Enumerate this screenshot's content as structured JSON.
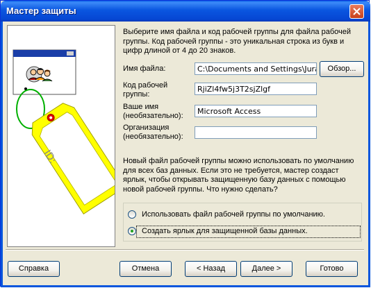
{
  "window": {
    "title": "Мастер защиты"
  },
  "intro_text": "Выберите имя файла и код рабочей группы для файла рабочей группы.  Код рабочей группы - это уникальная строка из букв и цифр длиной от 4 до 20 знаков.",
  "form": {
    "file_label": "Имя файла:",
    "file_value": "C:\\Documents and Settings\\Jura\\Pa",
    "browse_label": "Обзор...",
    "code_label_line1": "Код рабочей",
    "code_label_line2": "группы:",
    "code_value": "RjiZl4fw5j3T2sjZlgf",
    "name_label_line1": "Ваше имя",
    "name_label_line2": "(необязательно):",
    "name_value": "Microsoft Access",
    "org_label_line1": "Организация",
    "org_label_line2": "(необязательно):",
    "org_value": ""
  },
  "description": "Новый файл рабочей группы можно использовать по умолчанию для всех баз данных.  Если это не требуется, мастер создаст ярлык, чтобы открывать защищенную базу данных с помощью новой рабочей группы. Что нужно сделать?",
  "options": [
    {
      "label": "Использовать файл рабочей группы по умолчанию.",
      "selected": false
    },
    {
      "label": "Создать ярлык для защищенной базы данных.",
      "selected": true
    }
  ],
  "illustration": {
    "tag_text": "ID:"
  },
  "buttons": {
    "help": "Справка",
    "cancel": "Отмена",
    "back": "< Назад",
    "next": "Далее >",
    "finish": "Готово"
  },
  "colors": {
    "titlebar": "#0a56e0",
    "tag_yellow": "#ffff00",
    "ring_green": "#00b000",
    "selected_radio": "#21a121"
  }
}
